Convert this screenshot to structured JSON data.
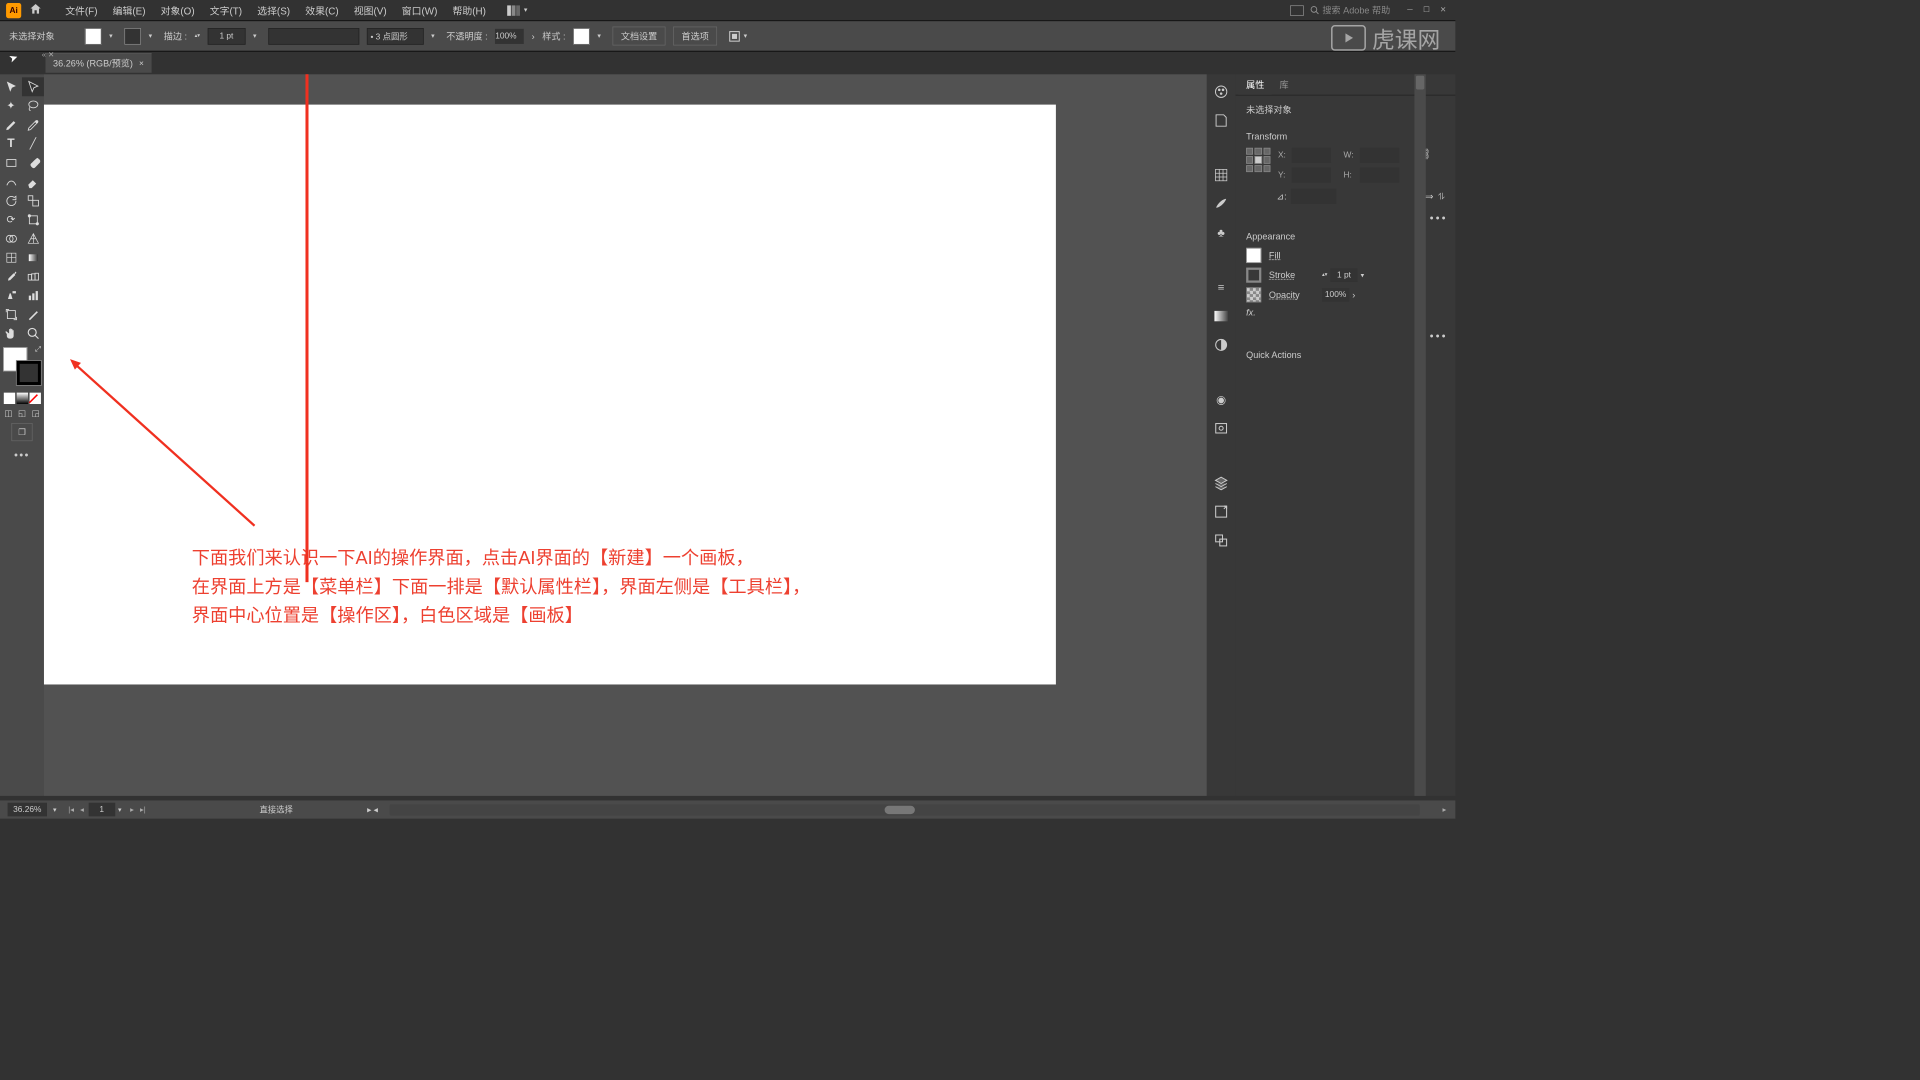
{
  "menubar": {
    "items": [
      "文件(F)",
      "编辑(E)",
      "对象(O)",
      "文字(T)",
      "选择(S)",
      "效果(C)",
      "视图(V)",
      "窗口(W)",
      "帮助(H)"
    ],
    "search_placeholder": "搜索 Adobe 帮助"
  },
  "options": {
    "no_selection": "未选择对象",
    "stroke_label": "描边 :",
    "stroke_weight": "1 pt",
    "brush_profile": "• 3 点圆形",
    "opacity_label": "不透明度 :",
    "opacity_value": "100%",
    "style_label": "样式 :",
    "doc_setup": "文档设置",
    "preferences": "首选项"
  },
  "document": {
    "tab_title": "36.26% (RGB/预览)"
  },
  "annotation": {
    "line1": "下面我们来认识一下AI的操作界面，点击AI界面的【新建】一个画板，",
    "line2": "在界面上方是【菜单栏】下面一排是【默认属性栏】，界面左侧是【工具栏】，",
    "line3": "界面中心位置是【操作区】，白色区域是【画板】"
  },
  "properties": {
    "tab_props": "属性",
    "tab_lib": "库",
    "no_selection": "未选择对象",
    "transform_title": "Transform",
    "x_label": "X:",
    "y_label": "Y:",
    "w_label": "W:",
    "h_label": "H:",
    "x_val": "",
    "y_val": "",
    "w_val": "",
    "h_val": "",
    "angle_label": "⊿:",
    "appearance_title": "Appearance",
    "fill_label": "Fill",
    "stroke_label": "Stroke",
    "stroke_val": "1 pt",
    "opacity_label": "Opacity",
    "opacity_val": "100%",
    "fx_label": "fx.",
    "quick_actions": "Quick Actions"
  },
  "statusbar": {
    "zoom": "36.26%",
    "artboard_num": "1",
    "tool_name": "直接选择"
  },
  "watermark": "虎课网"
}
